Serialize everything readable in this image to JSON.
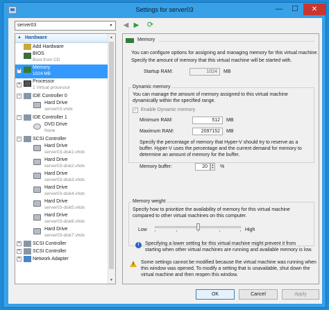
{
  "window": {
    "title": "Settings for server03",
    "min": "—",
    "max": "☐",
    "close": "✕"
  },
  "selector": {
    "value": "server03",
    "arrow": "▾"
  },
  "nav": {
    "back": "◀",
    "forward": "▶",
    "refresh": "⟳"
  },
  "tree": {
    "header": "Hardware",
    "items": [
      {
        "label": "Add Hardware",
        "sub": "",
        "icon": "add-hardware-icon"
      },
      {
        "label": "BIOS",
        "sub": "Boot from CD",
        "icon": "bios-chip-icon"
      },
      {
        "label": "Memory",
        "sub": "1024 MB",
        "icon": "memory-icon",
        "selected": true,
        "expander": "+"
      },
      {
        "label": "Processor",
        "sub": "1 Virtual processor",
        "icon": "processor-icon",
        "expander": "+"
      },
      {
        "label": "IDE Controller 0",
        "sub": "",
        "icon": "controller-icon",
        "expander": "−"
      },
      {
        "label": "Hard Drive",
        "sub": "server03.vhdx",
        "icon": "hard-drive-icon",
        "child": true
      },
      {
        "label": "IDE Controller 1",
        "sub": "",
        "icon": "controller-icon",
        "expander": "−"
      },
      {
        "label": "DVD Drive",
        "sub": "None",
        "icon": "dvd-drive-icon",
        "child": true
      },
      {
        "label": "SCSI Controller",
        "sub": "",
        "icon": "controller-icon",
        "expander": "−"
      },
      {
        "label": "Hard Drive",
        "sub": "server03-disk1.vhdx",
        "icon": "hard-drive-icon",
        "child": true
      },
      {
        "label": "Hard Drive",
        "sub": "server03-disk2.vhdx",
        "icon": "hard-drive-icon",
        "child": true
      },
      {
        "label": "Hard Drive",
        "sub": "server03-disk3.vhdx",
        "icon": "hard-drive-icon",
        "child": true
      },
      {
        "label": "Hard Drive",
        "sub": "server03-disk4.vhdx",
        "icon": "hard-drive-icon",
        "child": true
      },
      {
        "label": "Hard Drive",
        "sub": "server03-disk5.vhdx",
        "icon": "hard-drive-icon",
        "child": true
      },
      {
        "label": "Hard Drive",
        "sub": "server03-disk6.vhdx",
        "icon": "hard-drive-icon",
        "child": true
      },
      {
        "label": "Hard Drive",
        "sub": "server03-disk7.vhdx",
        "icon": "hard-drive-icon",
        "child": true
      },
      {
        "label": "SCSI Controller",
        "sub": "",
        "icon": "controller-icon",
        "expander": "+",
        "compact": true
      },
      {
        "label": "SCSI Controller",
        "sub": "",
        "icon": "controller-icon",
        "expander": "+",
        "compact": true
      },
      {
        "label": "Network Adapter",
        "sub": "",
        "icon": "network-adapter-icon",
        "expander": "+",
        "compact": true
      }
    ]
  },
  "memory": {
    "heading": "Memory",
    "intro": "You can configure options for assigning and managing memory for this virtual machine.",
    "specify": "Specify the amount of memory that this virtual machine will be started with.",
    "startup_label": "Startup RAM:",
    "startup_value": "1024",
    "unit_mb": "MB",
    "dynamic": {
      "title": "Dynamic memory",
      "desc1": "You can manage the amount of memory assigned to this virtual machine",
      "desc2": "dynamically within the specified range.",
      "enable_label": "Enable Dynamic memory",
      "enable_checked": true,
      "min_label": "Minimum RAM:",
      "min_value": "512",
      "max_label": "Maximum RAM:",
      "max_value": "2097152",
      "buffer_p1": "Specify the percentage of memory that Hyper-V should try to reserve as a",
      "buffer_p2": "buffer. Hyper-V uses the percentage and the current demand for memory to",
      "buffer_p3": "determine an amount of memory for the buffer.",
      "buffer_label": "Memory buffer:",
      "buffer_value": "20",
      "buffer_unit": "%"
    },
    "weight": {
      "title": "Memory weight",
      "desc1": "Specify how to prioritize the availability of memory for this virtual machine",
      "desc2": "compared to other virtual machines on this computer.",
      "low": "Low",
      "high": "High",
      "level": 0.5,
      "info1": "Specifying a lower setting for this virtual machine might prevent it from",
      "info2": "starting when other virtual machines are running and available memory is low."
    },
    "warning": {
      "l1": "Some settings cannot be modified because the virtual machine was running when",
      "l2": "this window was opened. To modify a setting that is unavailable, shut down the",
      "l3": "virtual machine and then reopen this window."
    }
  },
  "buttons": {
    "ok": "OK",
    "cancel": "Cancel",
    "apply": "Apply"
  }
}
